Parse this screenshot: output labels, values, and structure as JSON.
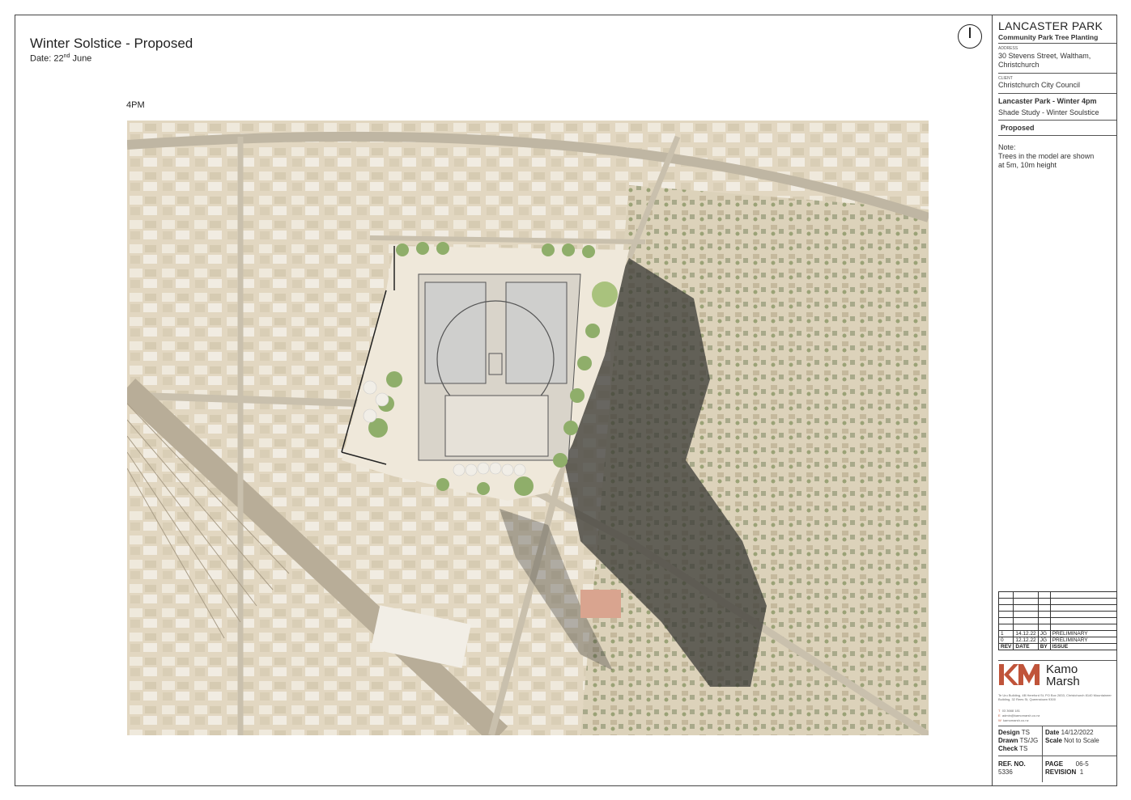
{
  "sheet": {
    "title": "Winter Solstice  - Proposed",
    "date_prefix": "Date: 22",
    "date_sup": "nd",
    "date_suffix": " June",
    "time_label": "4PM"
  },
  "north_arrow": {
    "icon": "north-arrow-icon"
  },
  "map": {
    "description_icon": "aerial-site-plan-image",
    "colors": {
      "ground": "#e6dcc8",
      "shadow": "#3a3a36",
      "pitch": "#ede4d6",
      "tree": "#8fae6a"
    }
  },
  "title_block": {
    "project_name": "LANCASTER PARK",
    "project_sub": "Community Park Tree Planting",
    "address_label": "ADDRESS",
    "address_line1": "30 Stevens Street, Waltham,",
    "address_line2": "Christchurch",
    "client_label": "CLIENT",
    "client": "Christchurch City Council",
    "drawing_title": "Lancaster Park - Winter 4pm",
    "drawing_sub": "Shade Study - Winter Soulstice",
    "status": "Proposed",
    "note_title": "Note:",
    "note_line1": "Trees in the model are shown",
    "note_line2": "at 5m, 10m height"
  },
  "revisions": {
    "headers": {
      "rev": "REV",
      "date": "DATE",
      "by": "BY",
      "issue": "ISSUE"
    },
    "rows": [
      {
        "rev": "1",
        "date": "14.12.22",
        "by": "JG",
        "issue": "PRELIMINARY"
      },
      {
        "rev": "0",
        "date": "12.12.22",
        "by": "JG",
        "issue": "PRELIMINARY"
      }
    ]
  },
  "firm": {
    "name_line1": "Kamo",
    "name_line2": "Marsh",
    "logo_icon": "kamo-marsh-logo-icon",
    "accent": "#c0543a",
    "address": "Te Uru Building, 4B Hereford St, PO Box 2833, Christchurch 8140 Mountaineer Building, 32 Rees St, Queenstown 9300",
    "phone": "03 3668 181",
    "email": "admin@kamomarsh.co.nz",
    "web": "kamomarsh.co.nz",
    "phone_key": "T",
    "email_key": "E",
    "web_key": "W"
  },
  "drawing_info": {
    "design_label": "Design",
    "design": "TS",
    "drawn_label": "Drawn",
    "drawn": "TS/JG",
    "check_label": "Check",
    "check": "TS",
    "date_label": "Date",
    "date": "14/12/2022",
    "scale_label": "Scale",
    "scale": "Not to Scale",
    "ref_label": "REF. NO.",
    "ref": "5336",
    "page_label": "PAGE",
    "page": "06-5",
    "revision_label": "REVISION",
    "revision": "1"
  }
}
